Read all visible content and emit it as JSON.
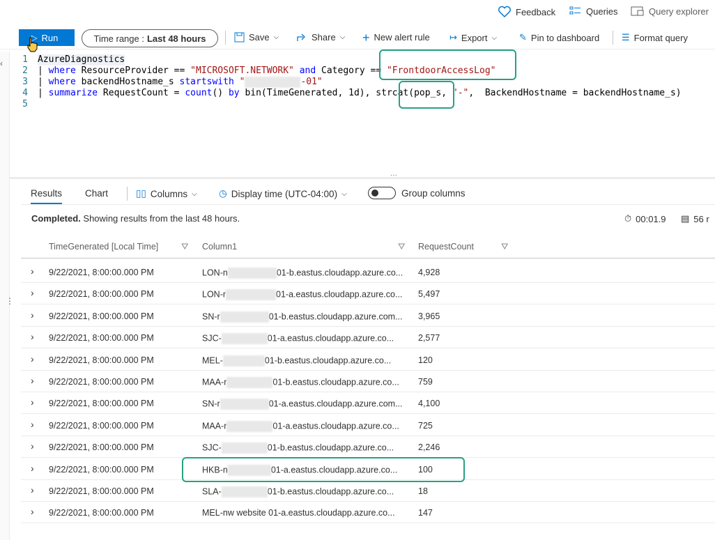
{
  "topbar": {
    "feedback": "Feedback",
    "queries": "Queries",
    "query_explorer": "Query explorer"
  },
  "toolbar": {
    "run": "Run",
    "time_range_label": "Time range :",
    "time_range_value": "Last 48 hours",
    "save": "Save",
    "share": "Share",
    "new_alert_rule": "New alert rule",
    "export": "Export",
    "pin_to_dashboard": "Pin to dashboard",
    "format_query": "Format query"
  },
  "editor": {
    "lines": [
      {
        "num": "1"
      },
      {
        "num": "2"
      },
      {
        "num": "3"
      },
      {
        "num": "4"
      },
      {
        "num": "5"
      }
    ],
    "l1": "AzureDiagnostics",
    "l2_pipe": "| ",
    "l2_kw": "where",
    "l2_a": " ResourceProvider == ",
    "l2_s1": "\"MICROSOFT.NETWORK\"",
    "l2_and": " and",
    "l2_b": " Category == ",
    "l2_s2": "\"FrontdoorAccessLog\"",
    "l3_pipe": "| ",
    "l3_kw": "where",
    "l3_a": " backendHostname_s ",
    "l3_kw2": "startswith",
    "l3_s1": " \"",
    "l3_s2": "-01\"",
    "l4_pipe": "| ",
    "l4_kw": "summarize",
    "l4_a": " RequestCount = ",
    "l4_kw2": "count",
    "l4_b": "() ",
    "l4_kw3": "by",
    "l4_c": " bin(TimeGenerated, 1d), strcat(pop_s, ",
    "l4_s": "\"-\"",
    "l4_d": ",  BackendHostname = backendHostname_s)"
  },
  "results": {
    "tabs": [
      "Results",
      "Chart"
    ],
    "columns_btn": "Columns",
    "display_time": "Display time (UTC-04:00)",
    "group_columns": "Group columns",
    "status_bold": "Completed.",
    "status_text": " Showing results from the last 48 hours.",
    "duration": "00:01.9",
    "records": "56 r",
    "headers": [
      "TimeGenerated [Local Time]",
      "Column1",
      "RequestCount"
    ],
    "rows": [
      {
        "time": "9/22/2021, 8:00:00.000 PM",
        "prefix": "LON-n",
        "suffix": "01-b.eastus.cloudapp.azure.co...",
        "count": "4,928"
      },
      {
        "time": "9/22/2021, 8:00:00.000 PM",
        "prefix": "LON-r",
        "suffix": "01-a.eastus.cloudapp.azure.co...",
        "count": "5,497"
      },
      {
        "time": "9/22/2021, 8:00:00.000 PM",
        "prefix": "SN-r",
        "suffix": "01-b.eastus.cloudapp.azure.com...",
        "count": "3,965"
      },
      {
        "time": "9/22/2021, 8:00:00.000 PM",
        "prefix": "SJC-",
        "suffix": "01-a.eastus.cloudapp.azure.co...",
        "count": "2,577"
      },
      {
        "time": "9/22/2021, 8:00:00.000 PM",
        "prefix": "MEL-",
        "suffix": "01-b.eastus.cloudapp.azure.co...",
        "count": "120"
      },
      {
        "time": "9/22/2021, 8:00:00.000 PM",
        "prefix": "MAA-r",
        "suffix": "01-b.eastus.cloudapp.azure.co...",
        "count": "759"
      },
      {
        "time": "9/22/2021, 8:00:00.000 PM",
        "prefix": "SN-r",
        "suffix": "01-a.eastus.cloudapp.azure.com...",
        "count": "4,100"
      },
      {
        "time": "9/22/2021, 8:00:00.000 PM",
        "prefix": "MAA-r",
        "suffix": "01-a.eastus.cloudapp.azure.co...",
        "count": "725"
      },
      {
        "time": "9/22/2021, 8:00:00.000 PM",
        "prefix": "SJC-",
        "suffix": "01-b.eastus.cloudapp.azure.co...",
        "count": "2,246"
      },
      {
        "time": "9/22/2021, 8:00:00.000 PM",
        "prefix": "HKB-n",
        "suffix": "01-a.eastus.cloudapp.azure.co...",
        "count": "100"
      },
      {
        "time": "9/22/2021, 8:00:00.000 PM",
        "prefix": "SLA-",
        "suffix": "01-b.eastus.cloudapp.azure.co...",
        "count": "18"
      },
      {
        "time": "9/22/2021, 8:00:00.000 PM",
        "prefix": "MEL-nw website",
        "suffix": " 01-a.eastus.cloudapp.azure.co...",
        "count": "147"
      }
    ]
  },
  "colors": {
    "accent": "#0078d4",
    "highlight": "#27a085"
  }
}
